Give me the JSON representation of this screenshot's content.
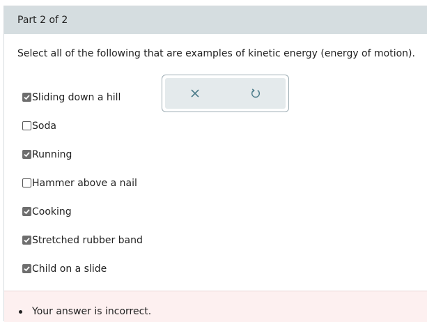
{
  "header": {
    "title": "Part 2 of 2"
  },
  "question": {
    "prompt": "Select all of the following that are examples of kinetic energy (energy of motion)."
  },
  "options": [
    {
      "label": "Sliding down a hill",
      "checked": true
    },
    {
      "label": "Soda",
      "checked": false
    },
    {
      "label": "Running",
      "checked": true
    },
    {
      "label": "Hammer above a nail",
      "checked": false
    },
    {
      "label": "Cooking",
      "checked": true
    },
    {
      "label": "Stretched rubber band",
      "checked": true
    },
    {
      "label": "Child on a slide",
      "checked": true
    }
  ],
  "toolbar": {
    "clear_icon": "x-icon",
    "undo_icon": "undo-icon"
  },
  "feedback": {
    "message": "Your answer is incorrect."
  },
  "colors": {
    "header_bg": "#d5dde0",
    "tool_icon": "#4d7c8a",
    "feedback_bg": "#fdf0f0"
  }
}
